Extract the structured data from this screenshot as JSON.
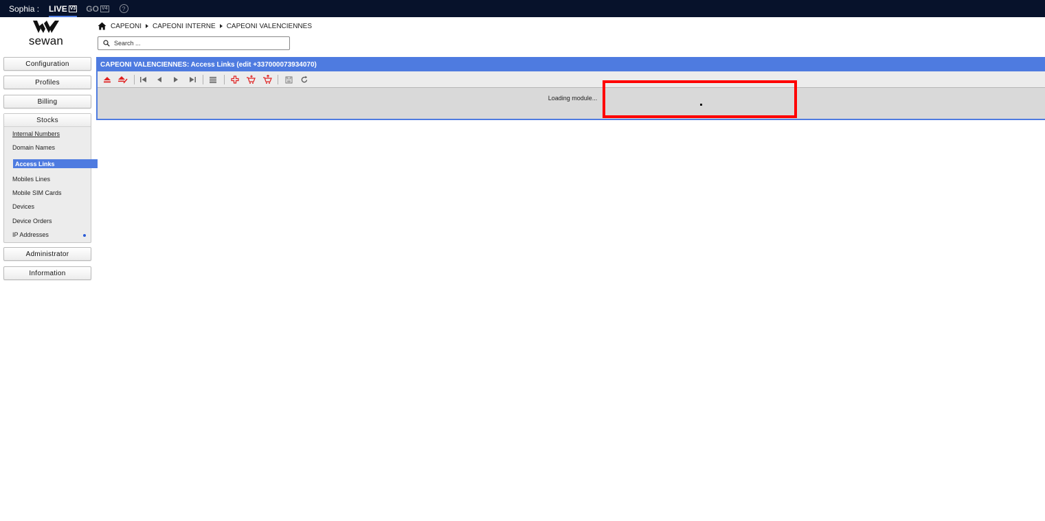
{
  "topbar": {
    "user_label": "Sophia :",
    "envs": [
      {
        "label": "LIVE",
        "version": "V3",
        "active": true
      },
      {
        "label": "GO",
        "version": "V4",
        "active": false
      }
    ],
    "help_icon": "help-circle-icon",
    "help_glyph": "?"
  },
  "logo": {
    "wordmark": "sewan"
  },
  "breadcrumb": {
    "home_icon": "home-icon",
    "items": [
      "CAPEONI",
      "CAPEONI INTERNE",
      "CAPEONI VALENCIENNES"
    ]
  },
  "search": {
    "placeholder": "Search ...",
    "value": "",
    "icon": "search-icon"
  },
  "sidebar": {
    "configuration": "Configuration",
    "profiles": "Profiles",
    "billing": "Billing",
    "stocks": {
      "label": "Stocks",
      "items": [
        "Internal Numbers",
        "Domain Names",
        "Access Links",
        "Mobiles Lines",
        "Mobile SIM Cards",
        "Devices",
        "Device Orders",
        "IP Addresses"
      ],
      "selected": "Access Links"
    },
    "administrator": "Administrator",
    "information": "Information"
  },
  "panel": {
    "title": "CAPEONI VALENCIENNES: Access Links (edit +337000073934070)",
    "loading_text": "Loading module...",
    "toolbar_icons": [
      "eject-icon",
      "eject-edit-icon",
      "first-page-icon",
      "previous-icon",
      "next-icon",
      "last-page-icon",
      "list-icon",
      "add-icon",
      "cart-add-icon",
      "cart-remove-icon",
      "save-icon",
      "reload-icon"
    ]
  },
  "colors": {
    "topbar_bg": "#07122b",
    "accent": "#4e7be0",
    "highlight": "#ff0000",
    "toolbar_red": "#e02020"
  }
}
